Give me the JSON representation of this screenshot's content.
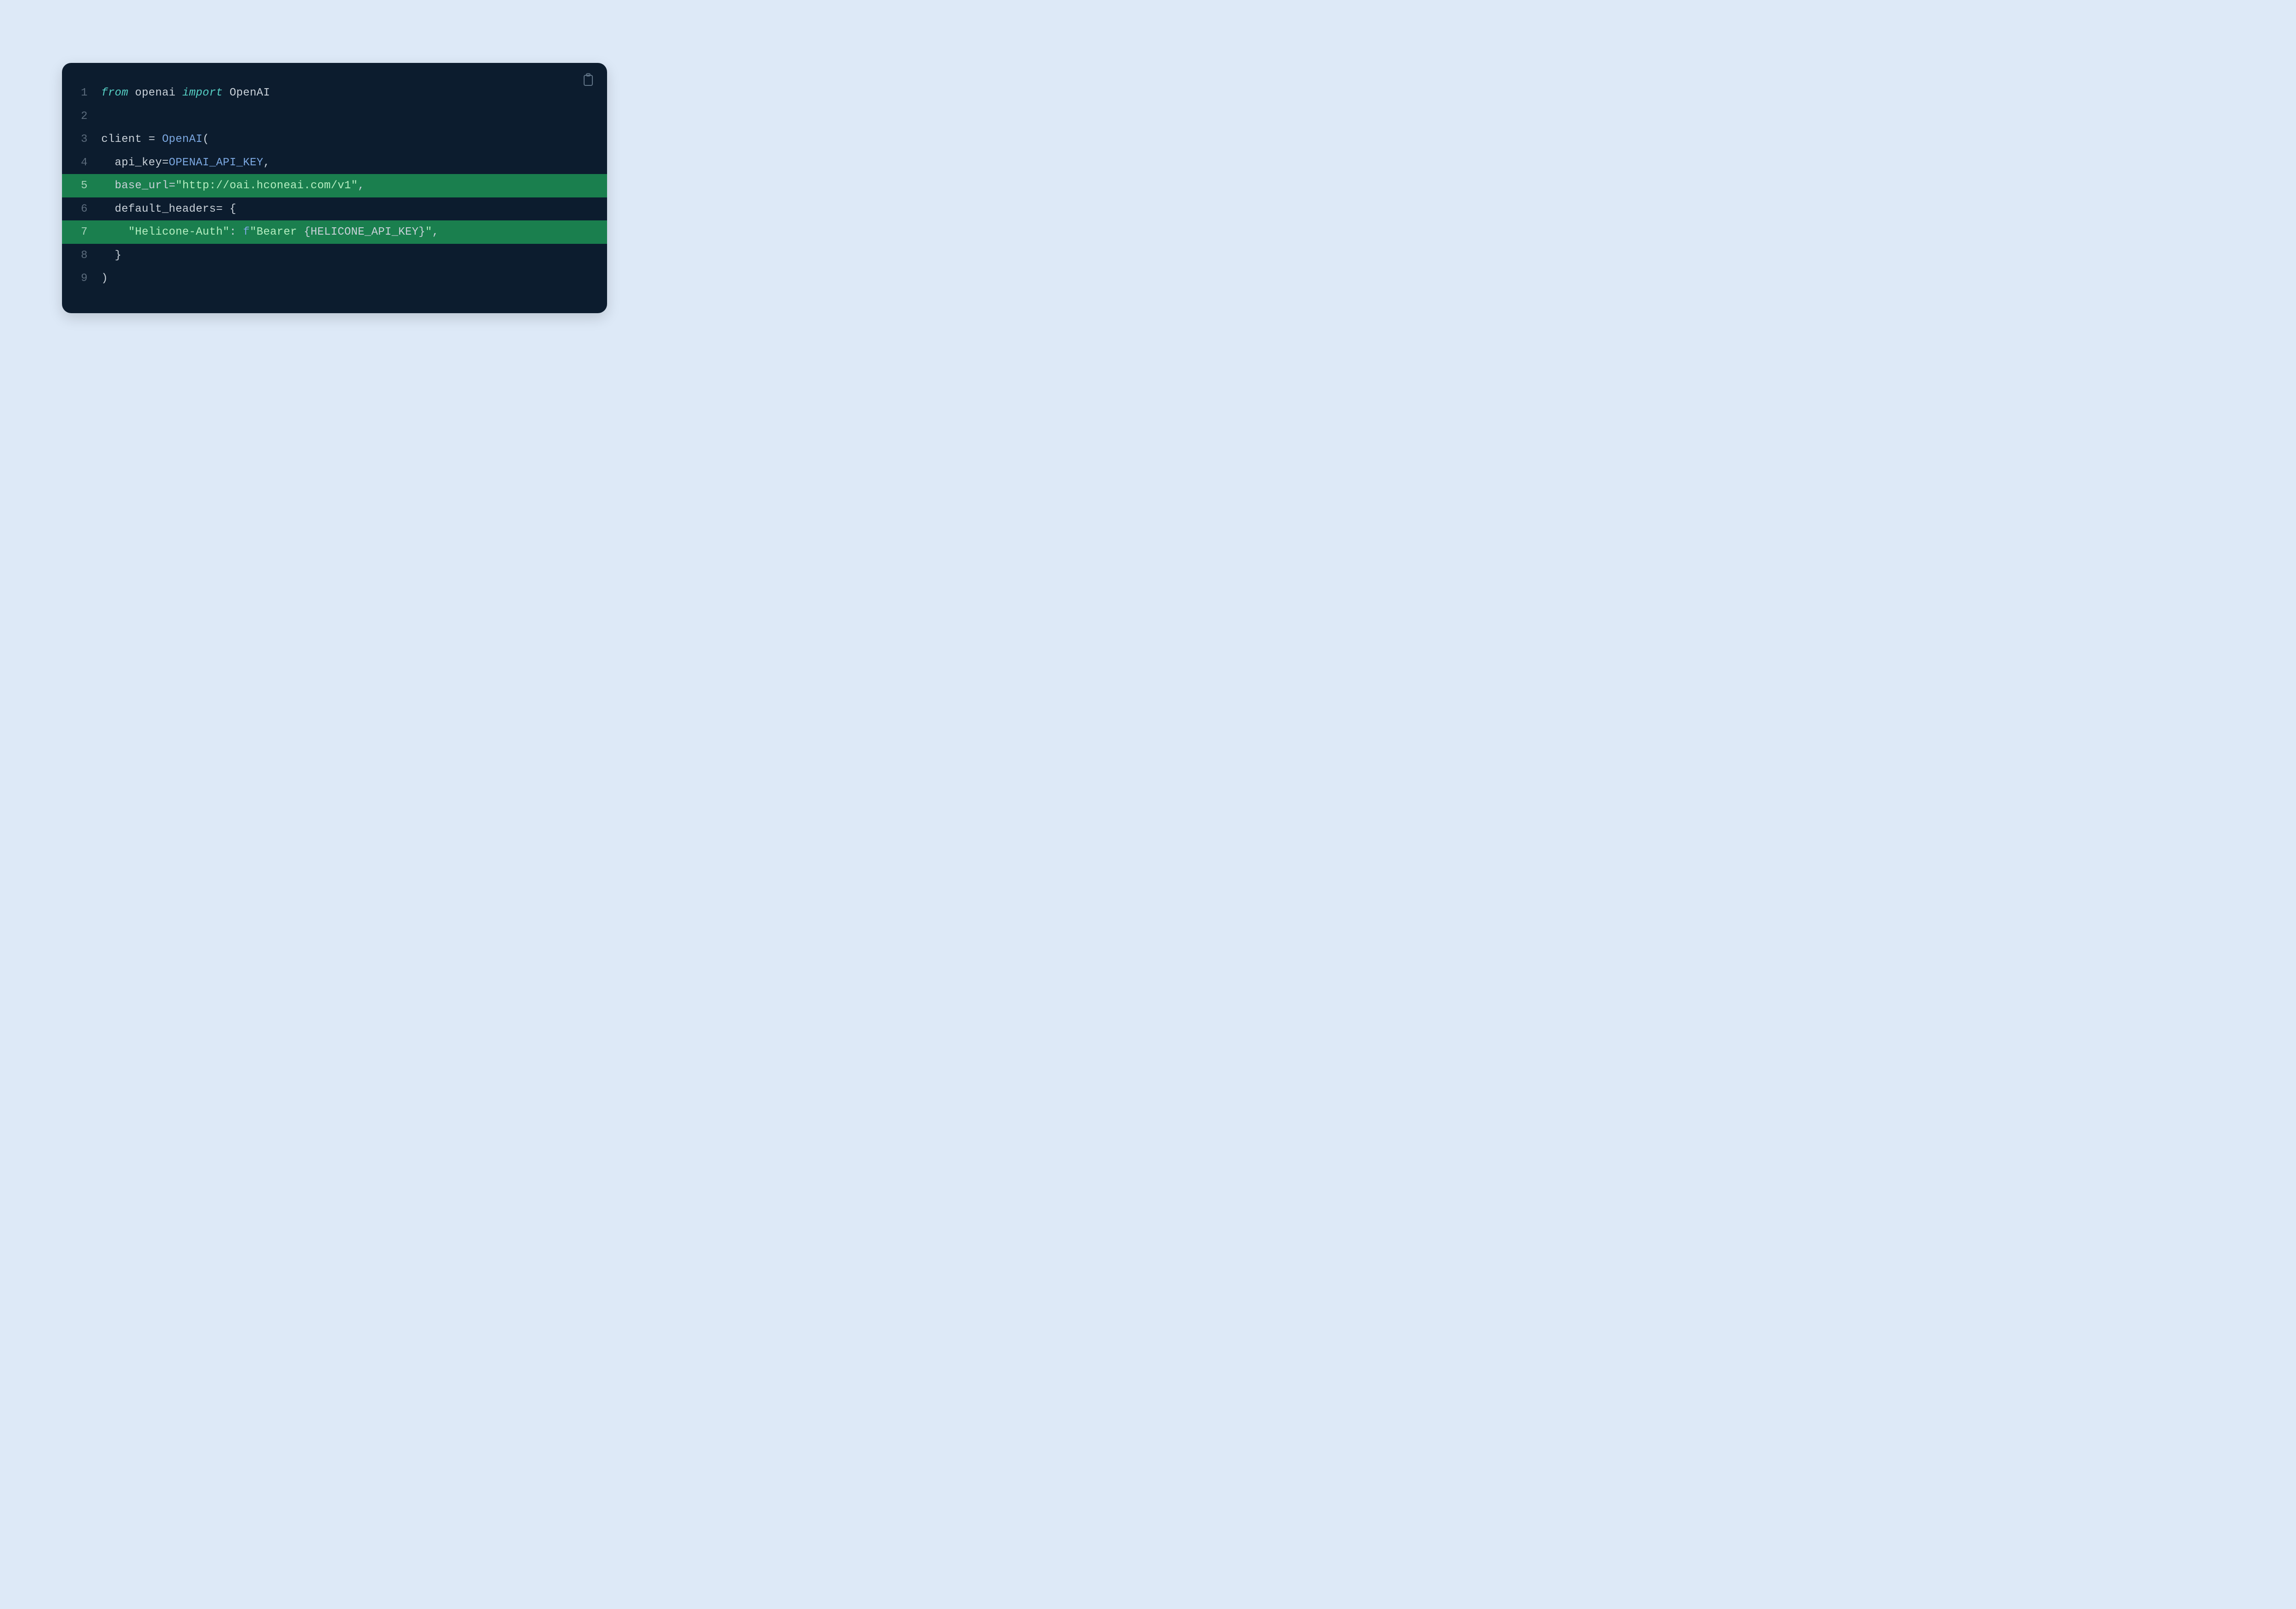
{
  "code": {
    "line1": {
      "num": "1",
      "from": "from",
      "module": "openai",
      "import": "import",
      "class": "OpenAI"
    },
    "line2": {
      "num": "2"
    },
    "line3": {
      "num": "3",
      "var": "client",
      "eq": " = ",
      "class": "OpenAI",
      "open": "("
    },
    "line4": {
      "num": "4",
      "indent": "  ",
      "param": "api_key",
      "eq": "=",
      "value": "OPENAI_API_KEY",
      "comma": ","
    },
    "line5": {
      "num": "5",
      "indent": "  ",
      "param": "base_url",
      "eq": "=",
      "q1": "\"",
      "url": "http://oai.hconeai.com/v1",
      "q2": "\"",
      "comma": ","
    },
    "line6": {
      "num": "6",
      "indent": "  ",
      "param": "default_headers",
      "eq": "= ",
      "brace": "{"
    },
    "line7": {
      "num": "7",
      "indent": "    ",
      "key_q1": "\"",
      "key": "Helicone-Auth",
      "key_q2": "\"",
      "colon": ": ",
      "f": "f",
      "val_q1": "\"",
      "bearer": "Bearer ",
      "lbrace": "{",
      "var": "HELICONE_API_KEY",
      "rbrace": "}",
      "val_q2": "\"",
      "comma": ","
    },
    "line8": {
      "num": "8",
      "indent": "  ",
      "brace": "}"
    },
    "line9": {
      "num": "9",
      "close": ")"
    }
  }
}
